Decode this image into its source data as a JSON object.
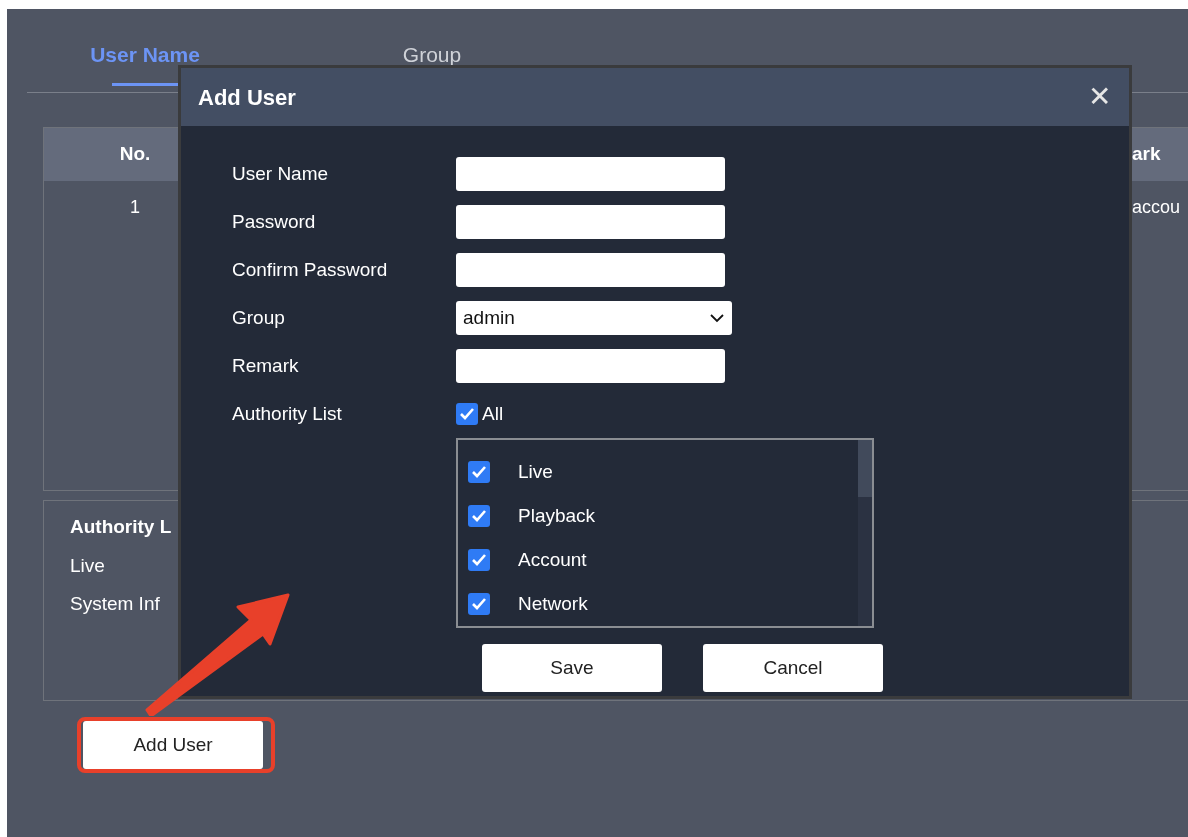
{
  "tabs": [
    {
      "label": "User Name",
      "selected": true
    },
    {
      "label": "Group",
      "selected": false
    }
  ],
  "user_table": {
    "columns": [
      "No.",
      "ark"
    ],
    "rows": [
      [
        "1",
        "accou"
      ]
    ]
  },
  "authority_panel": {
    "title": "Authority L",
    "items": [
      "Live",
      "System Inf"
    ]
  },
  "add_user_button": "Add User",
  "dialog": {
    "title": "Add User",
    "close": "✕",
    "fields": [
      {
        "label": "User Name",
        "kind": "text"
      },
      {
        "label": "Password",
        "kind": "password"
      },
      {
        "label": "Confirm Password",
        "kind": "password"
      },
      {
        "label": "Group",
        "kind": "select",
        "value": "admin"
      },
      {
        "label": "Remark",
        "kind": "text"
      },
      {
        "label": "Authority List",
        "kind": "checkbox",
        "option": "All",
        "checked": true
      }
    ],
    "authorities": [
      {
        "label": "Live",
        "checked": true
      },
      {
        "label": "Playback",
        "checked": true
      },
      {
        "label": "Account",
        "checked": true
      },
      {
        "label": "Network",
        "checked": true
      }
    ],
    "buttons": [
      "Save",
      "Cancel"
    ]
  }
}
